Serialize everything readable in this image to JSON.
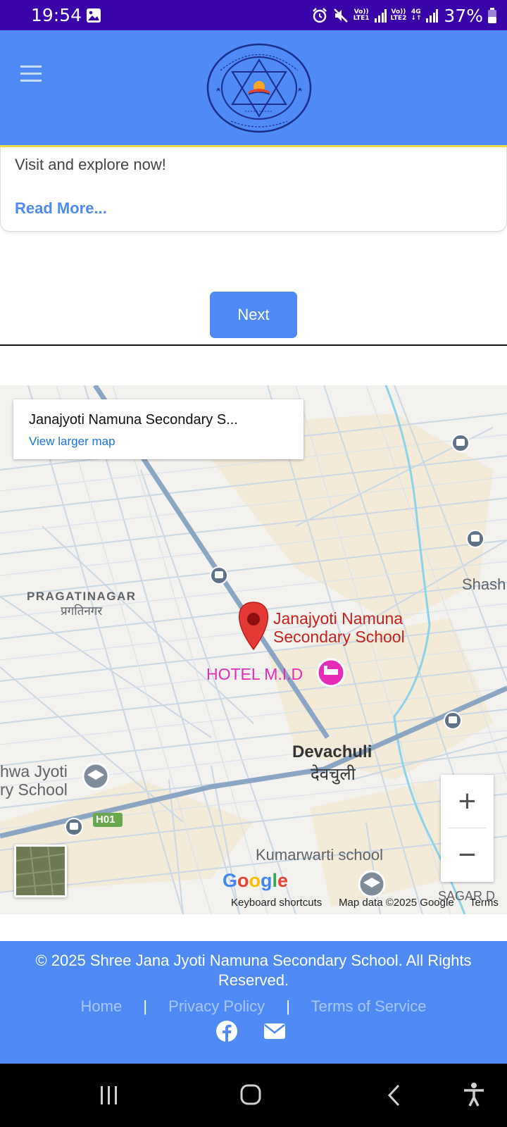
{
  "status_bar": {
    "time": "19:54",
    "sim1_label": "Vo)) LTE1",
    "sim2_label": "Vo)) LTE2",
    "network": "4G",
    "battery": "37%"
  },
  "header": {
    "menu_icon": "hamburger-menu-icon",
    "logo_icon": "school-logo-emblem"
  },
  "card": {
    "text": "Visit and explore now!",
    "read_more": "Read More..."
  },
  "pagination": {
    "next_label": "Next"
  },
  "map": {
    "place_title": "Janajyoti Namuna Secondary S...",
    "view_larger": "View larger map",
    "labels": {
      "pragatinagar": "PRAGATINAGAR",
      "pragatinagar_np": "प्रगतिनगर",
      "school_marker": "Janajyoti Namuna Secondary School",
      "hotel": "HOTEL M.I.D",
      "devachuli": "Devachuli",
      "devachuli_np": "देवचुली",
      "jyoti_school": "hwa Jyoti ry School",
      "jyoti_line1": "hwa Jyoti",
      "jyoti_line2": "ry School",
      "kumarwarti": "Kumarwarti school",
      "shash": "Shash",
      "sagar": "SAGAR D",
      "road_h01": "H01"
    },
    "google": "Google",
    "keyboard_shortcuts": "Keyboard shortcuts",
    "map_data": "Map data ©2025 Google",
    "terms": "Terms",
    "zoom_in": "+",
    "zoom_out": "−"
  },
  "footer": {
    "copyright": "© 2025 Shree Jana Jyoti Namuna Secondary School. All Rights Reserved.",
    "links": [
      "Home",
      "Privacy Policy",
      "Terms of Service"
    ],
    "separator": "|",
    "social_icons": [
      "facebook-icon",
      "email-icon"
    ]
  },
  "nav_bar": {
    "icons": [
      "recent-apps-icon",
      "home-icon",
      "back-icon",
      "accessibility-icon"
    ]
  },
  "colors": {
    "status_bar": "#3a05a8",
    "brand_blue": "#4f8af5",
    "header_border": "#f2d84b",
    "map_pin": "#e53935",
    "hotel_pink": "#e52bb7"
  }
}
